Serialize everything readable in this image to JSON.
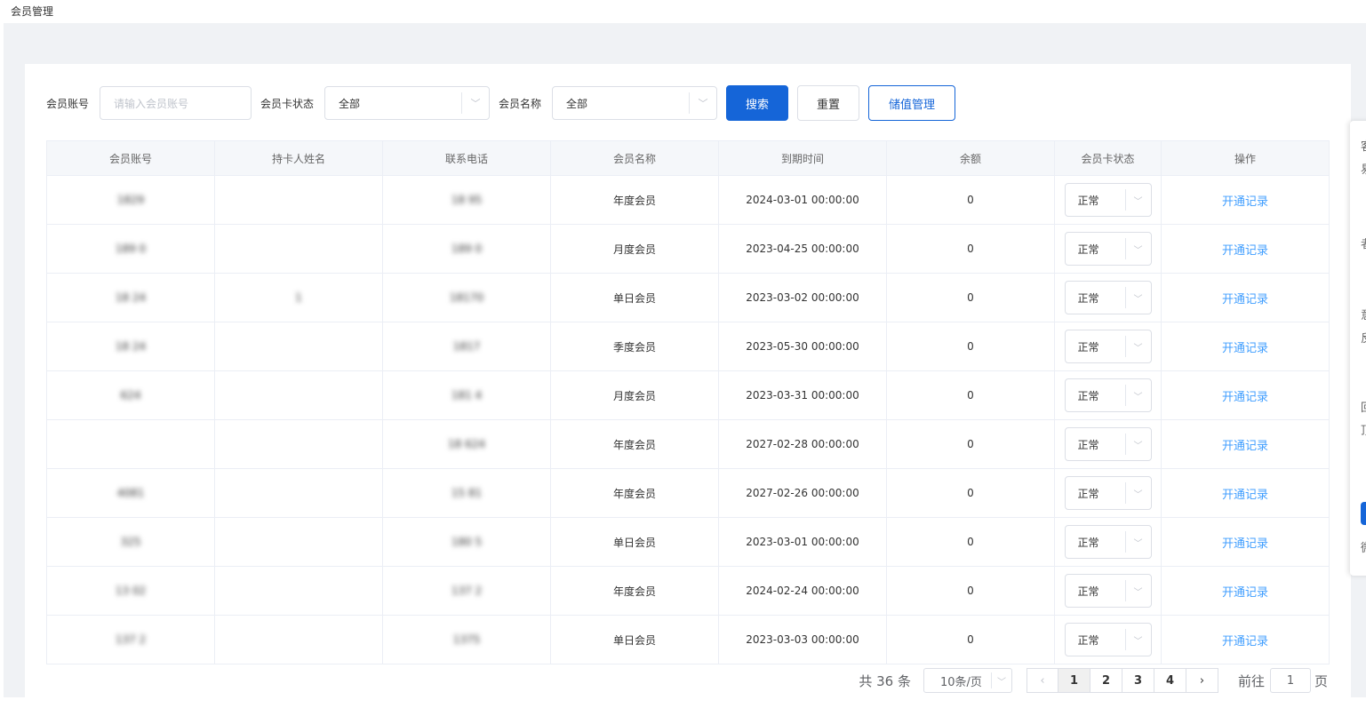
{
  "page": {
    "title": "会员管理"
  },
  "filters": {
    "account_label": "会员账号",
    "account_placeholder": "请输入会员账号",
    "card_status_label": "会员卡状态",
    "card_status_value": "全部",
    "member_name_label": "会员名称",
    "member_name_value": "全部",
    "search_label": "搜索",
    "reset_label": "重置",
    "stored_value_label": "储值管理"
  },
  "table": {
    "headers": [
      "会员账号",
      "持卡人姓名",
      "联系电话",
      "会员名称",
      "到期时间",
      "余额",
      "会员卡状态",
      "操作"
    ],
    "action_label": "开通记录",
    "rows": [
      {
        "account": "1829",
        "name": "",
        "phone": "18 95",
        "member": "年度会员",
        "expire": "2024-03-01 00:00:00",
        "balance": "0",
        "status": "正常"
      },
      {
        "account": "189 0",
        "name": "",
        "phone": "189 0",
        "member": "月度会员",
        "expire": "2023-04-25 00:00:00",
        "balance": "0",
        "status": "正常"
      },
      {
        "account": "18 24",
        "name": "1",
        "phone": "18170",
        "member": "单日会员",
        "expire": "2023-03-02 00:00:00",
        "balance": "0",
        "status": "正常"
      },
      {
        "account": "18 24",
        "name": "",
        "phone": "1817",
        "member": "季度会员",
        "expire": "2023-05-30 00:00:00",
        "balance": "0",
        "status": "正常"
      },
      {
        "account": "624",
        "name": "",
        "phone": "181 4",
        "member": "月度会员",
        "expire": "2023-03-31 00:00:00",
        "balance": "0",
        "status": "正常"
      },
      {
        "account": "",
        "name": "",
        "phone": "18 624",
        "member": "年度会员",
        "expire": "2027-02-28 00:00:00",
        "balance": "0",
        "status": "正常"
      },
      {
        "account": "4081",
        "name": "",
        "phone": "15 81",
        "member": "年度会员",
        "expire": "2027-02-26 00:00:00",
        "balance": "0",
        "status": "正常"
      },
      {
        "account": "325",
        "name": "",
        "phone": "180 5",
        "member": "单日会员",
        "expire": "2023-03-01 00:00:00",
        "balance": "0",
        "status": "正常"
      },
      {
        "account": "13 02",
        "name": "",
        "phone": "137 2",
        "member": "年度会员",
        "expire": "2024-02-24 00:00:00",
        "balance": "0",
        "status": "正常"
      },
      {
        "account": "137 2",
        "name": "",
        "phone": "1375",
        "member": "单日会员",
        "expire": "2023-03-03 00:00:00",
        "balance": "0",
        "status": "正常"
      }
    ]
  },
  "pagination": {
    "total_text": "共 36 条",
    "page_size": "10条/页",
    "pages": [
      "1",
      "2",
      "3",
      "4"
    ],
    "current_page": "1",
    "goto_label": "前往",
    "goto_value": "1",
    "page_suffix": "页"
  },
  "side_panel": {
    "chars": [
      "客",
      "易",
      "者",
      "意",
      "反",
      "回",
      "顶",
      "微"
    ]
  }
}
